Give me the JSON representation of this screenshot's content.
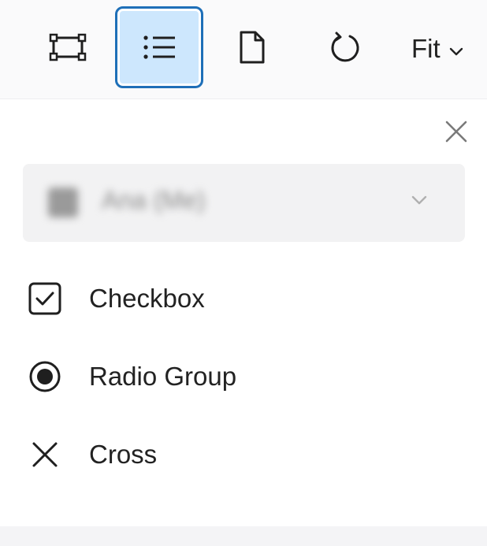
{
  "toolbar": {
    "tools": [
      {
        "name": "select-area",
        "icon": "bounding-box-icon",
        "active": false
      },
      {
        "name": "fields-list",
        "icon": "list-icon",
        "active": true
      },
      {
        "name": "page",
        "icon": "document-icon",
        "active": false
      },
      {
        "name": "rotate",
        "icon": "rotate-clockwise-icon",
        "active": false
      }
    ],
    "zoom_label": "Fit",
    "active_color": "#cde7fd",
    "active_border": "#1e6fb8"
  },
  "panel": {
    "assignee": {
      "name": "Ana (Me)"
    },
    "fields": [
      {
        "label": "Checkbox",
        "icon": "checkbox-icon"
      },
      {
        "label": "Radio Group",
        "icon": "radio-icon"
      },
      {
        "label": "Cross",
        "icon": "cross-icon"
      }
    ]
  }
}
